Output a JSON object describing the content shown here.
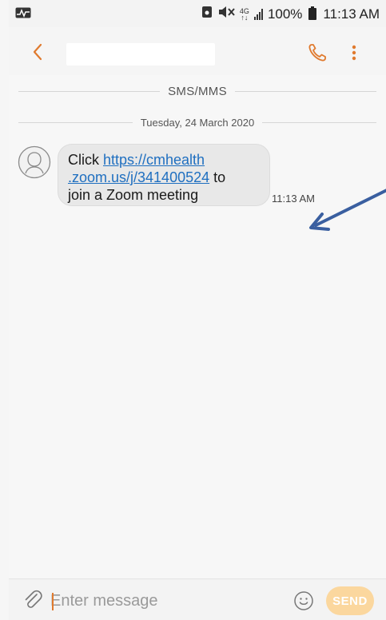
{
  "status_bar": {
    "battery": "100%",
    "time": "11:13 AM",
    "network": "4G"
  },
  "app_bar": {
    "contact_name": "",
    "icons": {
      "back": "chevron-left-icon",
      "call": "phone-icon",
      "menu": "more-vert-icon"
    },
    "accent": "#e07a2e"
  },
  "conversation": {
    "channel_label": "SMS/MMS",
    "date_label": "Tuesday, 24 March 2020",
    "messages": [
      {
        "prefix": "Click ",
        "link_line1": "https://cmhealth",
        "link_line2": ".zoom.us/j/341400524",
        "after_link": " to",
        "suffix": "join a Zoom meeting",
        "time": "11:13 AM"
      }
    ]
  },
  "annotation": {
    "color": "#3a5fa0"
  },
  "composer": {
    "placeholder": "Enter message",
    "send_label": "SEND",
    "send_color": "#fbd79e"
  }
}
